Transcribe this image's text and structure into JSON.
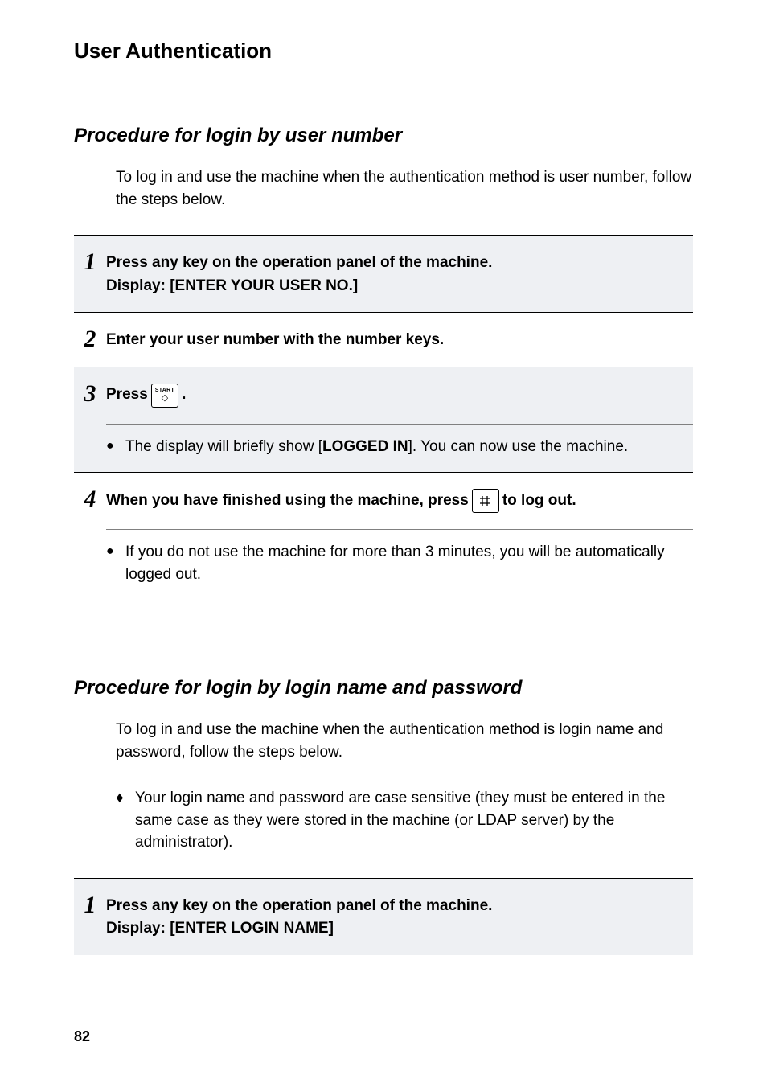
{
  "page_title": "User Authentication",
  "section_a": {
    "title": "Procedure for login by user number",
    "intro": "To log in and use the machine when the authentication method is user number, follow the steps below.",
    "steps": [
      {
        "num": "1",
        "line1": "Press any key on the operation panel of the machine.",
        "line2": "Display: [ENTER YOUR USER NO.]"
      },
      {
        "num": "2",
        "line1": "Enter your user number with the number keys."
      },
      {
        "num": "3",
        "prefix": "Press ",
        "suffix": ".",
        "key_label": "START",
        "bullet_before": "The display will briefly show [",
        "bullet_bold": "LOGGED IN",
        "bullet_after": "]. You can now use the machine."
      },
      {
        "num": "4",
        "prefix": "When you have finished using the machine, press ",
        "suffix": " to log out.",
        "bullet": "If you do not use the machine for more than 3 minutes, you will be automatically logged out."
      }
    ]
  },
  "section_b": {
    "title": "Procedure for login by login name and password",
    "intro": "To log in and use the machine when the authentication method is login name and password, follow the steps below.",
    "note": "Your login name and password are case sensitive (they must be entered in the same case as they were stored in the machine (or LDAP server) by the administrator).",
    "steps": [
      {
        "num": "1",
        "line1": "Press any key on the operation panel of the machine.",
        "line2": "Display: [ENTER LOGIN NAME]"
      }
    ]
  },
  "page_number": "82"
}
